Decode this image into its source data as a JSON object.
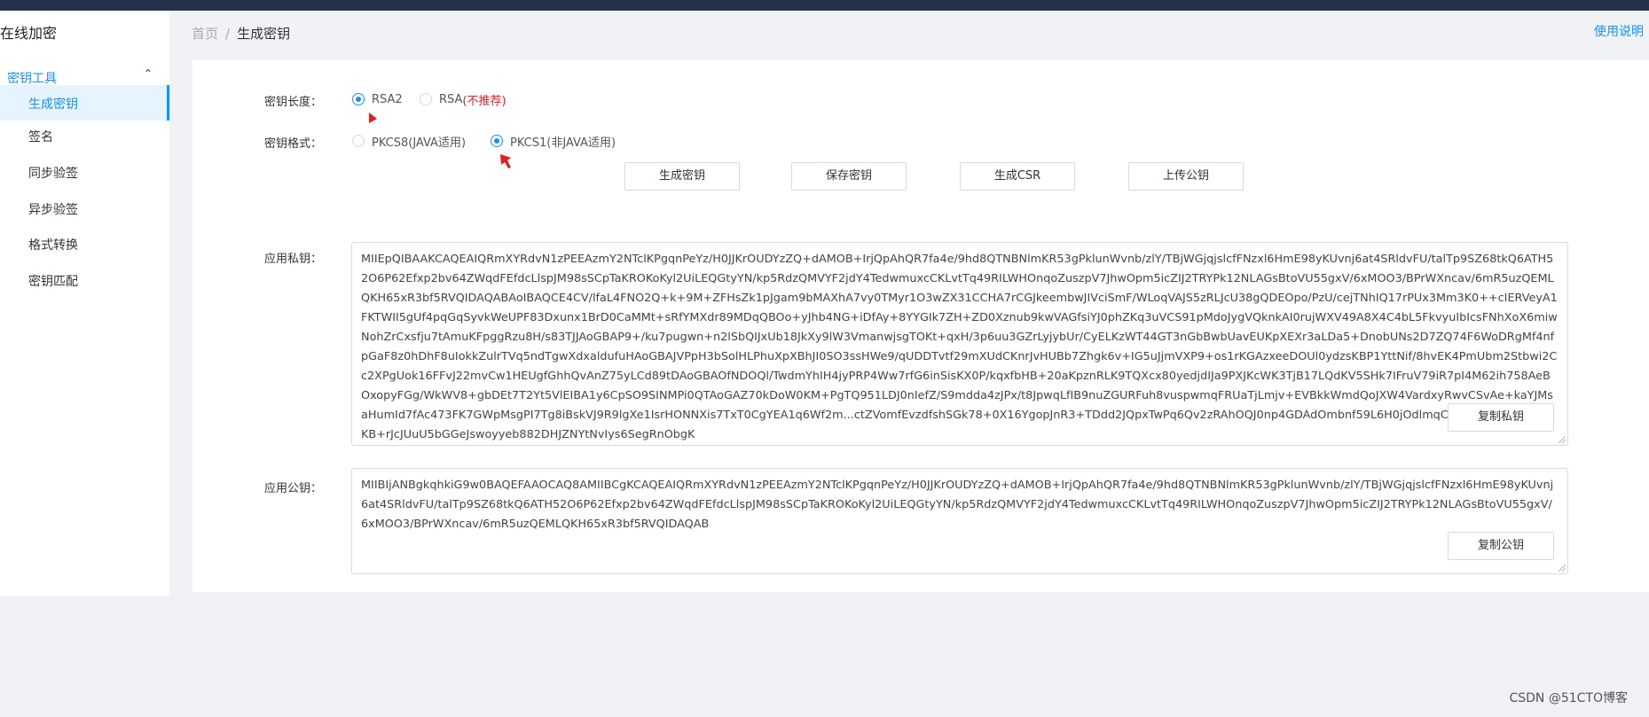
{
  "app": {
    "title": "在线加密"
  },
  "sidebar": {
    "group_label": "密钥工具",
    "items": [
      {
        "label": "生成密钥",
        "active": true
      },
      {
        "label": "签名"
      },
      {
        "label": "同步验签"
      },
      {
        "label": "异步验签"
      },
      {
        "label": "格式转换"
      },
      {
        "label": "密钥匹配"
      }
    ]
  },
  "breadcrumb": {
    "home": "首页",
    "separator": "/",
    "current": "生成密钥"
  },
  "help_link": "使用说明",
  "form": {
    "key_length": {
      "label": "密钥长度：",
      "options": [
        {
          "label": "RSA2",
          "checked": true
        },
        {
          "label": "RSA",
          "warning": "(不推荐)"
        }
      ]
    },
    "key_format": {
      "label": "密钥格式：",
      "options": [
        {
          "label": "PKCS8(JAVA适用)"
        },
        {
          "label": "PKCS1(非JAVA适用)",
          "checked": true
        }
      ]
    },
    "buttons": {
      "generate": "生成密钥",
      "save": "保存密钥",
      "csr": "生成CSR",
      "upload": "上传公钥"
    },
    "private_key": {
      "label": "应用私钥：",
      "value": "MIIEpQIBAAKCAQEAIQRmXYRdvN1zPEEAzmY2NTclKPgqnPeYz/H0JJKrOUDYzZQ+dAMOB+IrjQpAhQR7fa4e/9hd8QTNBNlmKR53gPklunWvnb/zlY/TBjWGjqjslcfFNzxl6HmE98yKUvnj6at4SRldvFU/talTp9SZ68tkQ6ATH52O6P62Efxp2bv64ZWqdFEfdcLlspJM98sSCpTaKROKoKyl2UiLEQGtyYN/kp5RdzQMVYF2jdY4TedwmuxcCKLvtTq49RILWHOnqoZuszpV7JhwOpm5icZIJ2TRYPk12NLAGsBtoVU55gxV/6xMOO3/BPrWXncav/6mR5uzQEMLQKH65xR3bf5RVQIDAQABAoIBAQCE4CV/lfaL4FNO2Q+k+9M+ZFHsZk1pJgam9bMAXhA7vy0TMyr1O3wZX31CCHA7rCGJkeembwJIVciSmF/WLoqVAJS5zRLJcU38gQDEOpo/PzU/cejTNhIQ17rPUx3Mm3K0++cIERVeyA1FKTWII5gUf4pqGqSyvkWeUPF83Dxunx1BrD0CaMMt+sRfYMXdr89MDqQBOo+yJhb4NG+iDfAy+8YYGIk7ZH+ZD0Xznub9kwVAGfsiYJ0phZKq3uVCS91pMdoJygVQknkAI0rujWXV49A8X4C4bL5FkvyuIbIcsFNhXoX6miwNohZrCxsfju7tAmuKFpggRzu8H/s83TJJAoGBAP9+/ku7pugwn+n2lSbQIJxUb18JkXy9lW3VmanwjsgTOKt+qxH/3p6uu3GZrLyjybUr/CyELKzWT44GT3nGbBwbUavEUKpXEXr3aLDa5+DnobUNs2D7ZQ74F6WoDRgMf4nfpGaF8z0hDhF8uIokkZulrTVq5ndTgwXdxaldufuHAoGBAJVPpH3bSolHLPhuXpXBhJI0SO3ssHWe9/qUDDTvtf29mXUdCKnrJvHUBb7Zhgk6v+IG5uJjmVXP9+os1rKGAzxeeDOUl0ydzsKBP1YttNif/8hvEK4PmUbm2Stbwi2Cc2XPgUok16FFvJ22mvCw1HEUgfGhhQvAnZ75yLCd89tDAoGBAOfNDOQl/TwdmYhIH4jyPRP4Ww7rfG6inSisKX0P/kqxfbHB+20aKpznRLK9TQXcx80yedjdIJa9PXJKcWK3TjB17LQdKV5SHk7IFruV79iR7pI4M62ih758AeBOxopyFGg/WkWV8+gbDEt7T2Yt5VlEIBA1y6CpSO9SINMPi0QTAoGAZ70kDoW0KM+PgTQ951LDJ0nIefZ/S9mdda4zJPx/t8JpwqLfIB9nuZGURFuh8vuspwmqFRUaTjLmjv+EVBkkWmdQoJXW4VardxyRwvCSvAe+kaYJMsaHumId7fAc473FK7GWpMsgPI7Tg8iBskVJ9R9lgXe1IsrHONNXis7TxT0CgYEA1q6Wf2m...ctZVomfEvzdfshSGk78+0X16YgopJnR3+TDdd2JQpxTwPq6Qv2zRAhOQJ0np4GDAdOmbnf59L6H0jOdlmqC07DQgfa+NITiGF4KB+rJcJUuU5bGGeJswoyyeb882DHJZNYtNvIys6SegRnObgK",
      "copy_button": "复制私钥"
    },
    "public_key": {
      "label": "应用公钥：",
      "value": "MIIBIjANBgkqhkiG9w0BAQEFAAOCAQ8AMIIBCgKCAQEAIQRmXYRdvN1zPEEAzmY2NTclKPgqnPeYz/H0JJKrOUDYzZQ+dAMOB+IrjQpAhQR7fa4e/9hd8QTNBNlmKR53gPklunWvnb/zlY/TBjWGjqjslcfFNzxl6HmE98yKUvnj6at4SRldvFU/talTp9SZ68tkQ6ATH52O6P62Efxp2bv64ZWqdFEfdcLlspJM98sSCpTaKROKoKyl2UiLEQGtyYN/kp5RdzQMVYF2jdY4TedwmuxcCKLvtTq49RILWHOnqoZuszpV7JhwOpm5icZIJ2TRYPk12NLAGsBtoVU55gxV/6xMOO3/BPrWXncav/6mR5uzQEMLQKH65xR3bf5RVQIDAQAB",
      "copy_button": "复制公钥"
    }
  },
  "watermark": "CSDN @51CTO博客",
  "colors": {
    "accent": "#1890ff",
    "warning": "#e02020",
    "topbar": "#27304a",
    "active_bg": "#e6f4ff"
  }
}
